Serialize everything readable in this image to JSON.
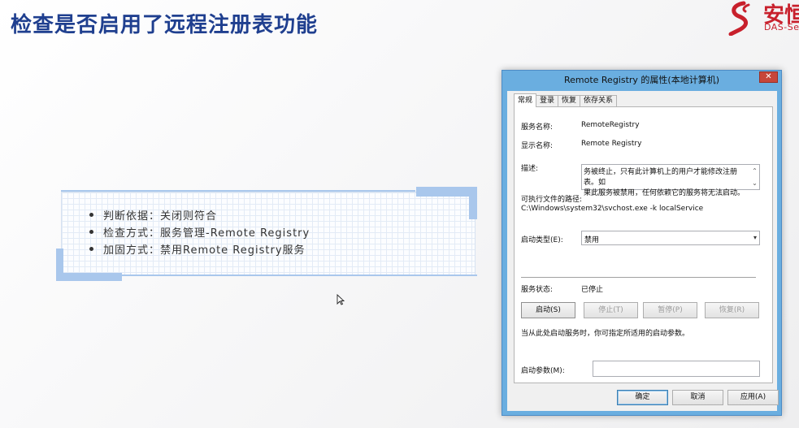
{
  "slide": {
    "title": "检查是否启用了远程注册表功能"
  },
  "logo": {
    "cn": "安恒",
    "en": "DAS-Security"
  },
  "info": {
    "bullets": [
      "判断依据：关闭则符合",
      "检查方式：服务管理-Remote Registry",
      "加固方式：禁用Remote Registry服务"
    ]
  },
  "dialog": {
    "title": "Remote Registry 的属性(本地计算机)",
    "close_label": "✕",
    "tabs": [
      "常规",
      "登录",
      "恢复",
      "依存关系"
    ],
    "service_name_label": "服务名称:",
    "service_name_value": "RemoteRegistry",
    "display_name_label": "显示名称:",
    "display_name_value": "Remote Registry",
    "description_label": "描述:",
    "description_text": "务被终止，只有此计算机上的用户才能修改注册表。如\n果此服务被禁用，任何依赖它的服务将无法启动。",
    "exe_path_label": "可执行文件的路径:",
    "exe_path_value": "C:\\Windows\\system32\\svchost.exe -k localService",
    "startup_type_label": "启动类型(E):",
    "startup_type_value": "禁用",
    "service_status_label": "服务状态:",
    "service_status_value": "已停止",
    "buttons": {
      "start": "启动(S)",
      "stop": "停止(T)",
      "pause": "暂停(P)",
      "resume": "恢复(R)"
    },
    "hint": "当从此处启动服务时，你可指定所适用的启动参数。",
    "start_params_label": "启动参数(M):",
    "start_params_value": "",
    "footer": {
      "ok": "确定",
      "cancel": "取消",
      "apply": "应用(A)"
    }
  }
}
